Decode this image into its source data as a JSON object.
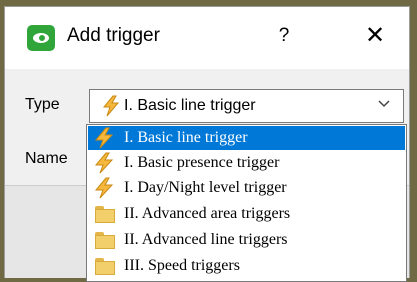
{
  "dialog": {
    "title": "Add trigger",
    "help_glyph": "?",
    "close_glyph": "✕"
  },
  "form": {
    "type_label": "Type",
    "name_label": "Name",
    "type_value": "I. Basic line trigger"
  },
  "dropdown": {
    "items": [
      {
        "label": "I. Basic line trigger",
        "icon": "lightning-icon",
        "selected": true
      },
      {
        "label": "I. Basic presence trigger",
        "icon": "lightning-icon",
        "selected": false
      },
      {
        "label": "I. Day/Night level trigger",
        "icon": "lightning-icon",
        "selected": false
      },
      {
        "label": "II. Advanced area triggers",
        "icon": "folder-icon",
        "selected": false
      },
      {
        "label": "II. Advanced line triggers",
        "icon": "folder-icon",
        "selected": false
      },
      {
        "label": "III. Speed triggers",
        "icon": "folder-icon",
        "selected": false
      }
    ]
  },
  "colors": {
    "accent_selection": "#0078d7",
    "app_icon": "#2fa53a",
    "bolt_fill": "#f5b83d",
    "folder": "#f3cf6b"
  }
}
